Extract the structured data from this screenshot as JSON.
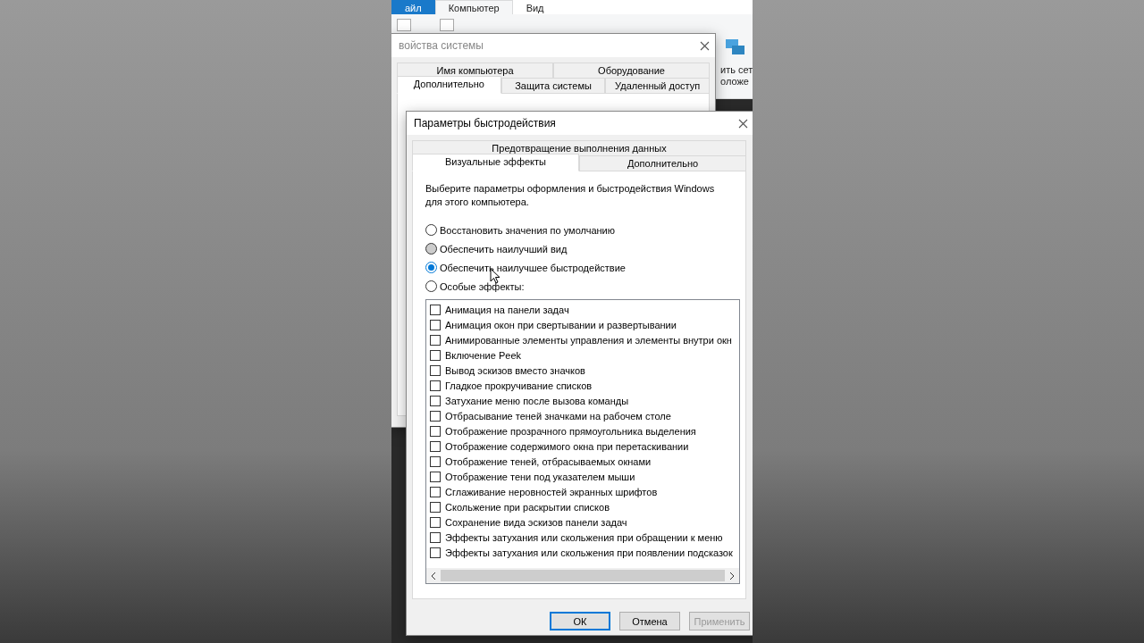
{
  "explorer": {
    "tabs": [
      {
        "label": "айл",
        "kind": "file",
        "selected": false
      },
      {
        "label": "Компьютер",
        "kind": "tab",
        "selected": true
      },
      {
        "label": "Вид",
        "kind": "tab",
        "selected": false
      }
    ],
    "ribbon_label_lines": [
      "ить сет",
      "оложе"
    ]
  },
  "system_properties": {
    "title": "войства системы",
    "tab_rows": [
      [
        {
          "label": "Имя компьютера",
          "selected": false
        },
        {
          "label": "Оборудование",
          "selected": false
        }
      ],
      [
        {
          "label": "Дополнительно",
          "selected": true
        },
        {
          "label": "Защита системы",
          "selected": false
        },
        {
          "label": "Удаленный доступ",
          "selected": false
        }
      ]
    ]
  },
  "performance": {
    "title": "Параметры быстродействия",
    "tab_rows": [
      [
        {
          "label": "Предотвращение выполнения данных",
          "selected": false
        }
      ],
      [
        {
          "label": "Визуальные эффекты",
          "selected": true
        },
        {
          "label": "Дополнительно",
          "selected": false
        }
      ]
    ],
    "description": "Выберите параметры оформления и быстродействия Windows для этого компьютера.",
    "options": [
      {
        "label": "Восстановить значения по умолчанию",
        "selected": false,
        "pressed": false
      },
      {
        "label": "Обеспечить наилучший вид",
        "selected": false,
        "pressed": true
      },
      {
        "label": "Обеспечить наилучшее быстродействие",
        "selected": true,
        "pressed": false
      },
      {
        "label": "Особые эффекты:",
        "selected": false,
        "pressed": false
      }
    ],
    "effects": [
      {
        "label": "Анимация на панели задач",
        "checked": false
      },
      {
        "label": "Анимация окон при свертывании и развертывании",
        "checked": false
      },
      {
        "label": "Анимированные элементы управления и элементы внутри окн",
        "checked": false
      },
      {
        "label": "Включение Peek",
        "checked": false
      },
      {
        "label": "Вывод эскизов вместо значков",
        "checked": false
      },
      {
        "label": "Гладкое прокручивание списков",
        "checked": false
      },
      {
        "label": "Затухание меню после вызова команды",
        "checked": false
      },
      {
        "label": "Отбрасывание теней значками на рабочем столе",
        "checked": false
      },
      {
        "label": "Отображение прозрачного прямоугольника выделения",
        "checked": false
      },
      {
        "label": "Отображение содержимого окна при перетаскивании",
        "checked": false
      },
      {
        "label": "Отображение теней, отбрасываемых окнами",
        "checked": false
      },
      {
        "label": "Отображение тени под указателем мыши",
        "checked": false
      },
      {
        "label": "Сглаживание неровностей экранных шрифтов",
        "checked": false
      },
      {
        "label": "Скольжение при раскрытии списков",
        "checked": false
      },
      {
        "label": "Сохранение вида эскизов панели задач",
        "checked": false
      },
      {
        "label": "Эффекты затухания или скольжения при обращении к меню",
        "checked": false
      },
      {
        "label": "Эффекты затухания или скольжения при появлении подсказок",
        "checked": false
      }
    ],
    "buttons": [
      {
        "label": "ОК",
        "kind": "default"
      },
      {
        "label": "Отмена",
        "kind": "normal"
      },
      {
        "label": "Применить",
        "kind": "disabled"
      }
    ]
  }
}
